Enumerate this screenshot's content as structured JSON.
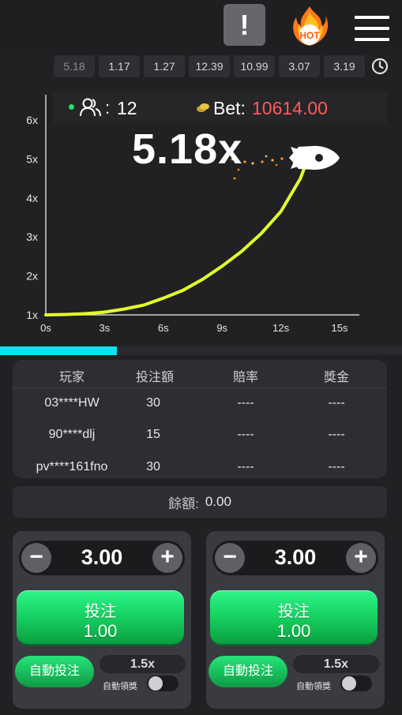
{
  "header": {
    "alert_symbol": "!",
    "hot_label": "HOT"
  },
  "history": [
    "5.18",
    "1.17",
    "1.27",
    "12.39",
    "10.99",
    "3.07",
    "3.19"
  ],
  "stats": {
    "players_count": "12",
    "players_sep": ":",
    "bet_label": "Bet:",
    "bet_value": "10614.00",
    "bet_color": "#ff5a5a",
    "online_dot_color": "#22dd66"
  },
  "round": {
    "multiplier": "5.18x",
    "elapsed_progress": 0.29
  },
  "chart_data": {
    "type": "line",
    "xlabel": "",
    "ylabel": "",
    "x_ticks": [
      "0s",
      "3s",
      "6s",
      "9s",
      "12s",
      "15s"
    ],
    "y_ticks": [
      "1x",
      "2x",
      "3x",
      "4x",
      "5x",
      "6x"
    ],
    "xlim": [
      0,
      18
    ],
    "ylim": [
      1,
      6
    ],
    "series": [
      {
        "color": "#e4ff2a",
        "x": [
          0,
          1,
          2,
          3,
          4,
          5,
          6,
          7,
          8,
          9,
          10,
          11,
          12,
          13,
          13.5
        ],
        "y": [
          1.0,
          1.01,
          1.03,
          1.07,
          1.15,
          1.25,
          1.43,
          1.63,
          1.91,
          2.25,
          2.63,
          3.09,
          3.65,
          4.5,
          5.18
        ]
      }
    ]
  },
  "bets_table": {
    "headers": [
      "玩家",
      "投注額",
      "賠率",
      "獎金"
    ],
    "rows": [
      [
        "03****HW",
        "30",
        "----",
        "----"
      ],
      [
        "90****dlj",
        "15",
        "----",
        "----"
      ],
      [
        "pv****161fno",
        "30",
        "----",
        "----"
      ]
    ]
  },
  "balance": {
    "label": "餘額:",
    "value": "0.00"
  },
  "bet_panels": [
    {
      "minus": "−",
      "plus": "+",
      "amount": "3.00",
      "bet_label": "投注",
      "bet_amount": "1.00",
      "auto_bet_label": "自動投注",
      "cashout_value": "1.5x",
      "auto_cashout_label": "自動領獎"
    },
    {
      "minus": "−",
      "plus": "+",
      "amount": "3.00",
      "bet_label": "投注",
      "bet_amount": "1.00",
      "auto_bet_label": "自動投注",
      "cashout_value": "1.5x",
      "auto_cashout_label": "自動領獎"
    }
  ],
  "colors": {
    "accent_green": "#18d564",
    "progress_cyan": "#0fe1f0",
    "curve": "#e4ff2a"
  }
}
